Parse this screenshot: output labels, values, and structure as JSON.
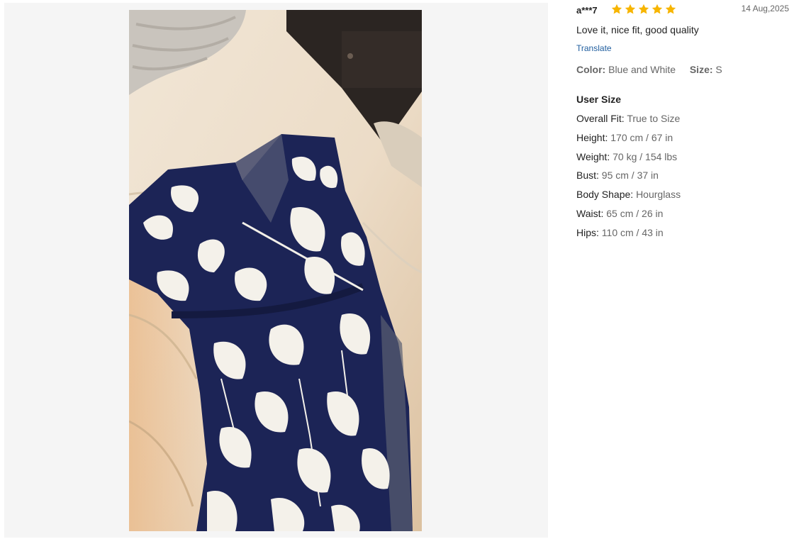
{
  "review": {
    "reviewer": "a***7",
    "rating": 5,
    "rating_max": 5,
    "star_color": "#f7b500",
    "date": "14 Aug,2025",
    "text": "Love it, nice fit, good quality",
    "translate_label": "Translate",
    "color_label": "Color:",
    "color_value": "Blue and White",
    "size_label": "Size:",
    "size_value": "S"
  },
  "user_size": {
    "title": "User Size",
    "rows": [
      {
        "label": "Overall Fit:",
        "value": "True to Size"
      },
      {
        "label": "Height:",
        "value": "170 cm / 67 in"
      },
      {
        "label": "Weight:",
        "value": "70 kg / 154 lbs"
      },
      {
        "label": "Bust:",
        "value": "95 cm / 37 in"
      },
      {
        "label": "Body Shape:",
        "value": "Hourglass"
      },
      {
        "label": "Waist:",
        "value": "65 cm / 26 in"
      },
      {
        "label": "Hips:",
        "value": "110 cm / 43 in"
      }
    ]
  },
  "photo": {
    "subject": "navy and white floral wrap dress laid on a bed"
  }
}
